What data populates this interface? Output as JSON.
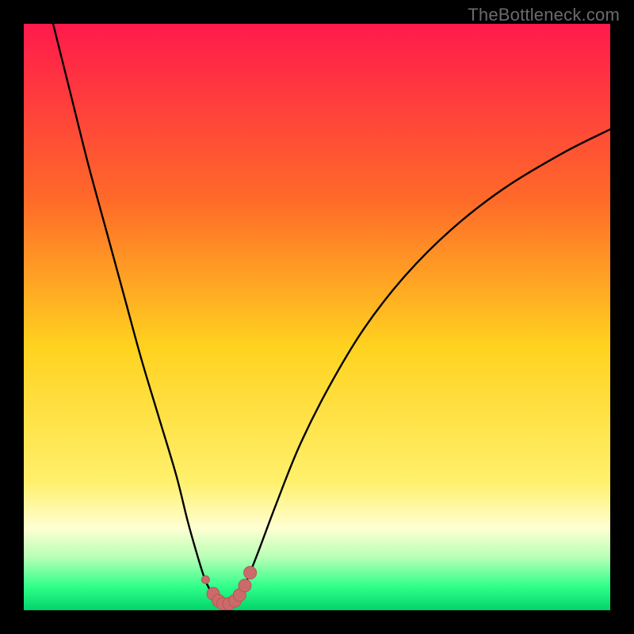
{
  "watermark": "TheBottleneck.com",
  "colors": {
    "frame": "#000000",
    "gradient_top": "#ff1a4c",
    "gradient_upper_mid": "#ff6a29",
    "gradient_mid": "#ffd21f",
    "gradient_lower_mid": "#fff06b",
    "gradient_pale": "#ffffd2",
    "gradient_light_green": "#b6ffb6",
    "gradient_green": "#2fff8a",
    "gradient_bottom": "#01d46a",
    "curve": "#000000",
    "marker_fill": "#cc6a6a",
    "marker_stroke": "#b05858"
  },
  "chart_data": {
    "type": "line",
    "title": "",
    "xlabel": "",
    "ylabel": "",
    "xlim": [
      0,
      100
    ],
    "ylim": [
      0,
      100
    ],
    "series": [
      {
        "name": "bottleneck-curve",
        "x": [
          5,
          8,
          11,
          14,
          17,
          20,
          23,
          26,
          28,
          30,
          31,
          32,
          33,
          34,
          35,
          36,
          37,
          38,
          40,
          43,
          47,
          52,
          58,
          65,
          73,
          82,
          92,
          100
        ],
        "y": [
          100,
          88,
          76,
          65,
          54,
          43,
          33,
          23,
          15,
          8,
          5,
          3,
          1.5,
          1,
          1,
          1.5,
          3,
          5,
          10,
          18,
          28,
          38,
          48,
          57,
          65,
          72,
          78,
          82
        ]
      }
    ],
    "markers": {
      "name": "highlighted-points",
      "x": [
        31.0,
        32.3,
        33.2,
        34.0,
        35.0,
        36.0,
        36.8,
        37.7,
        38.6
      ],
      "y": [
        5.2,
        2.8,
        1.6,
        1.1,
        1.1,
        1.6,
        2.6,
        4.2,
        6.4
      ],
      "r": [
        5,
        8,
        8,
        8,
        8,
        8,
        8,
        8,
        8
      ]
    },
    "gradient_stops": [
      {
        "offset": 0.0,
        "color": "#ff1a4c"
      },
      {
        "offset": 0.3,
        "color": "#ff6a29"
      },
      {
        "offset": 0.55,
        "color": "#ffd21f"
      },
      {
        "offset": 0.78,
        "color": "#fff06b"
      },
      {
        "offset": 0.86,
        "color": "#ffffd2"
      },
      {
        "offset": 0.91,
        "color": "#b6ffb6"
      },
      {
        "offset": 0.96,
        "color": "#2fff8a"
      },
      {
        "offset": 1.0,
        "color": "#01d46a"
      }
    ]
  }
}
